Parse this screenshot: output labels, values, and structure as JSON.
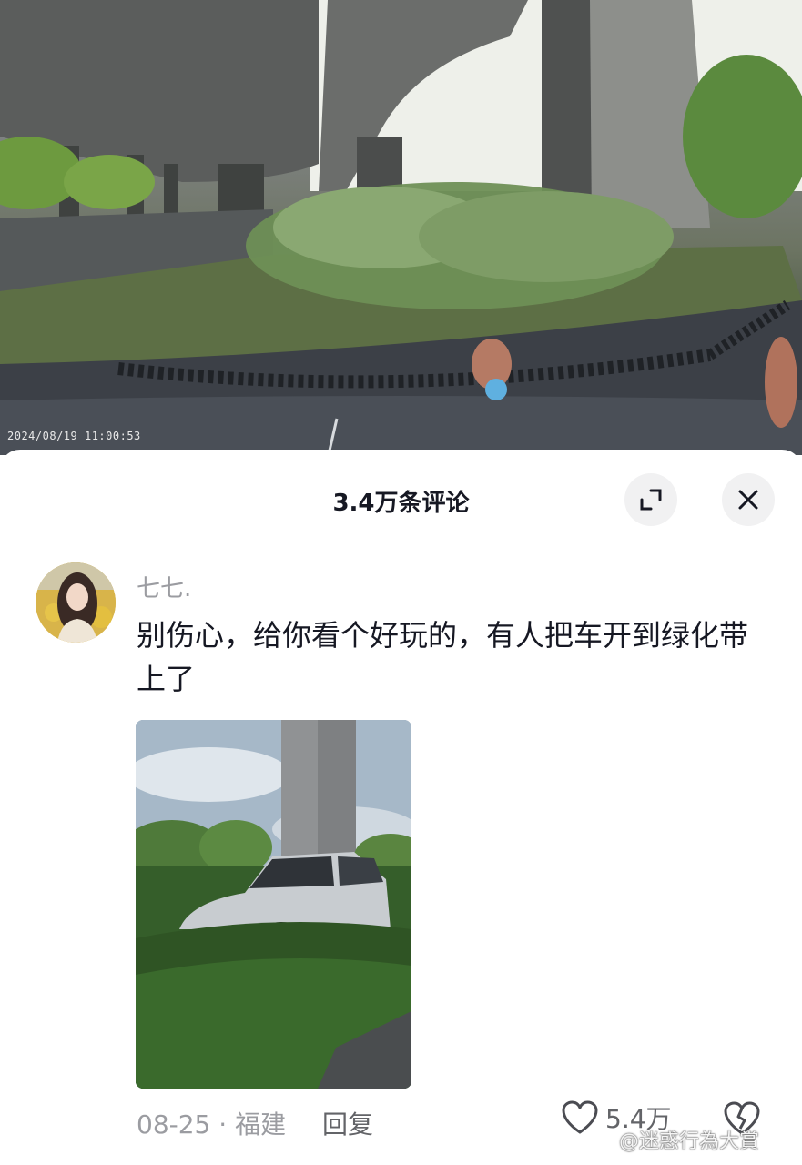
{
  "video": {
    "timestamp": "2024/08/19 11:00:53"
  },
  "sheet": {
    "title": "3.4万条评论",
    "expand_icon": "expand-icon",
    "close_icon": "close-icon"
  },
  "comment": {
    "username": "七七.",
    "text": "别伤心，给你看个好玩的，有人把车开到绿化带上了",
    "date_location": "08-25 · 福建",
    "reply_label": "回复",
    "like_count": "5.4万",
    "like_icon": "heart-outline-icon",
    "dislike_icon": "broken-heart-icon"
  },
  "watermark": "@迷惑行為大賞"
}
